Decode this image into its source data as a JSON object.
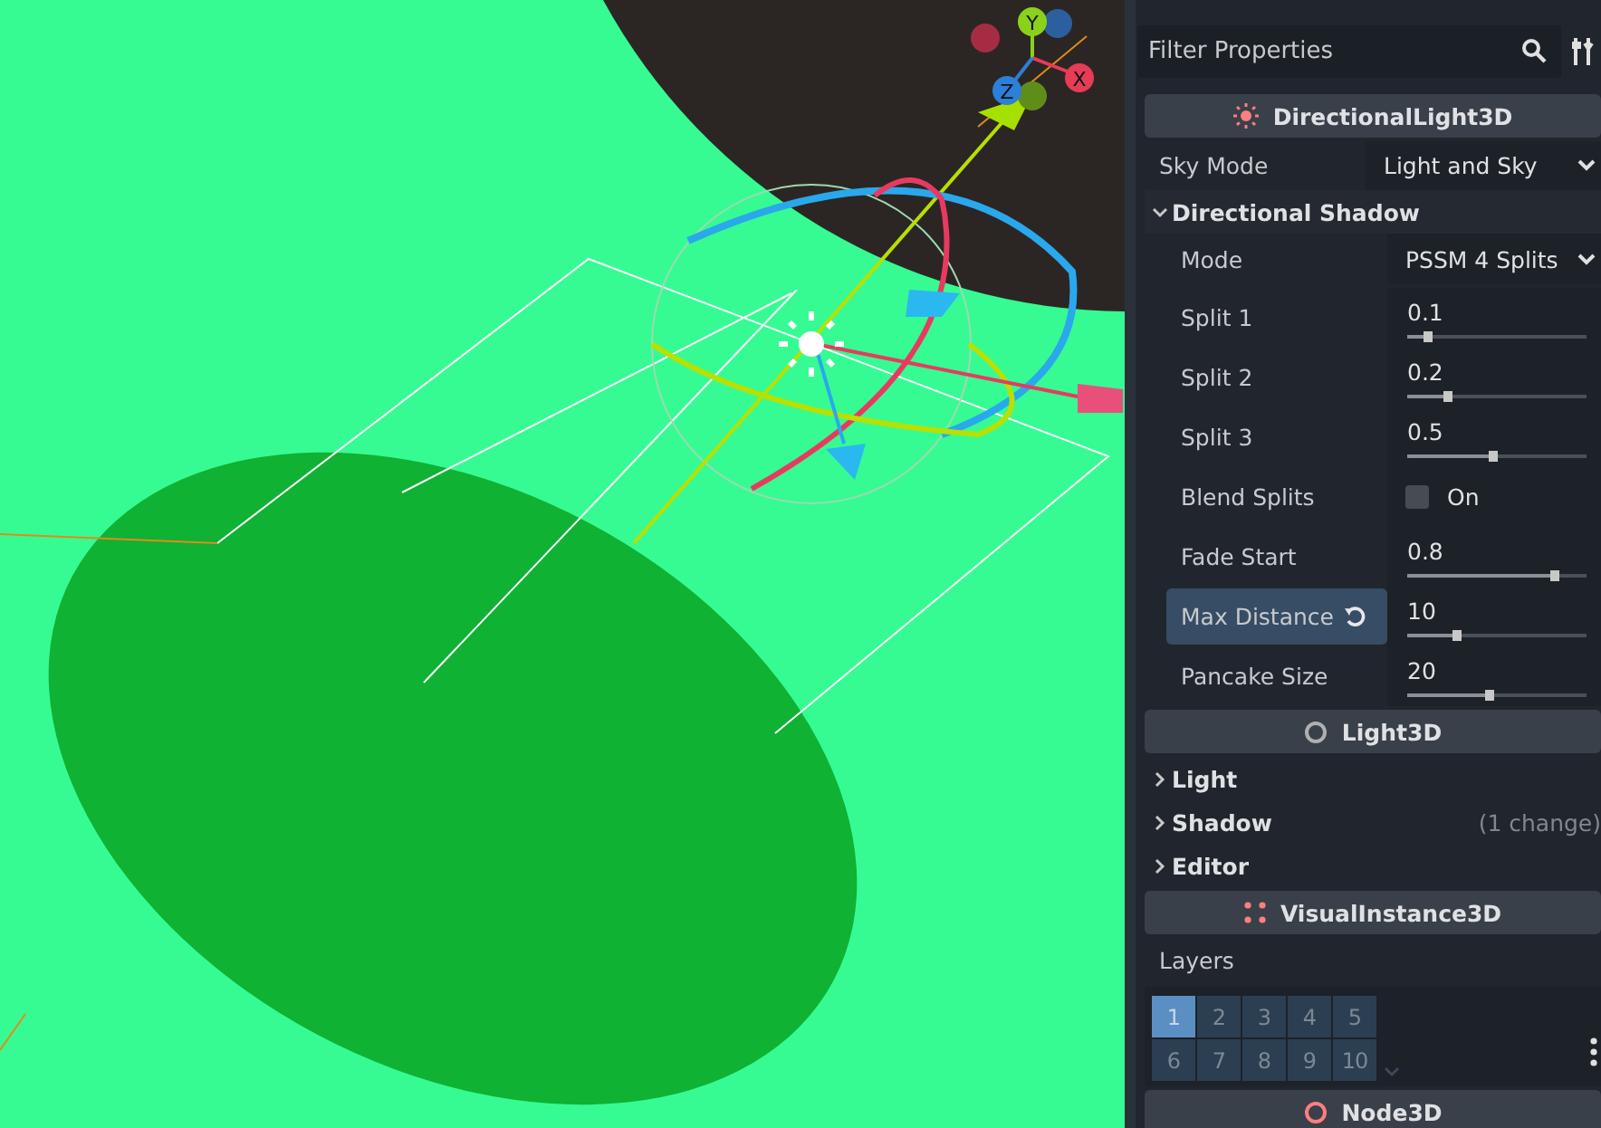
{
  "viewport": {
    "gizmo_axes": [
      {
        "label": "Y"
      },
      {
        "label": "X"
      },
      {
        "label": "Z"
      }
    ]
  },
  "inspector": {
    "filter": {
      "placeholder": "Filter Properties"
    },
    "items": [
      {
        "kind": "class-header",
        "label": "DirectionalLight3D",
        "color": "#fc7f7f"
      },
      {
        "kind": "dropdown",
        "label": "Sky Mode",
        "value": "Light and Sky",
        "highlighted": false
      },
      {
        "kind": "group",
        "label": "Directional Shadow",
        "expanded": true,
        "children": [
          {
            "kind": "dropdown",
            "label": "Mode",
            "value": "PSSM 4 Splits",
            "highlighted": false
          },
          {
            "kind": "slider",
            "label": "Split 1",
            "value": "0.1",
            "level": 0.11,
            "highlighted": false
          },
          {
            "kind": "slider",
            "label": "Split 2",
            "value": "0.2",
            "level": 0.22,
            "highlighted": false
          },
          {
            "kind": "slider",
            "label": "Split 3",
            "value": "0.5",
            "level": 0.47,
            "highlighted": false
          },
          {
            "kind": "checkbox",
            "label": "Blend Splits",
            "value": "On",
            "checked": false,
            "highlighted": false
          },
          {
            "kind": "slider",
            "label": "Fade Start",
            "value": "0.8",
            "level": 0.82,
            "highlighted": false
          },
          {
            "kind": "slider",
            "label": "Max Distance",
            "value": "10",
            "level": 0.27,
            "highlighted": true
          },
          {
            "kind": "slider",
            "label": "Pancake Size",
            "value": "20",
            "level": 0.45,
            "highlighted": false
          }
        ]
      },
      {
        "kind": "class-header",
        "label": "Light3D",
        "color": "#b0b0b0"
      },
      {
        "kind": "group",
        "label": "Light",
        "expanded": false
      },
      {
        "kind": "group",
        "label": "Shadow",
        "expanded": false,
        "note": "(1 change)"
      },
      {
        "kind": "group",
        "label": "Editor",
        "expanded": false
      },
      {
        "kind": "class-header",
        "label": "VisualInstance3D",
        "color": "#fc7f7f"
      },
      {
        "kind": "label",
        "label": "Layers"
      },
      {
        "kind": "layers",
        "cells": [
          {
            "label": "1",
            "selected": true
          },
          {
            "label": "2",
            "selected": false
          },
          {
            "label": "3",
            "selected": false
          },
          {
            "label": "4",
            "selected": false
          },
          {
            "label": "5",
            "selected": false
          },
          {
            "label": "6",
            "selected": false
          },
          {
            "label": "7",
            "selected": false
          },
          {
            "label": "8",
            "selected": false
          },
          {
            "label": "9",
            "selected": false
          },
          {
            "label": "10",
            "selected": false
          }
        ]
      },
      {
        "kind": "class-header",
        "label": "Node3D",
        "color": "#fc7f7f"
      }
    ]
  }
}
